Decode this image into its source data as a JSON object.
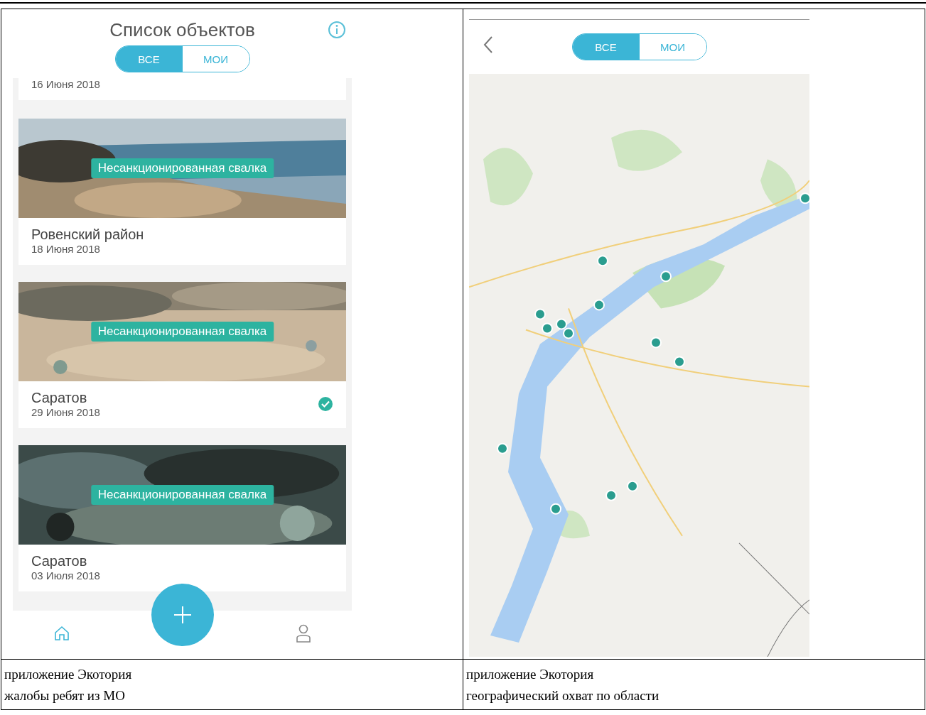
{
  "left_screen": {
    "title": "Список объектов",
    "tabs": [
      {
        "label": "ВСЕ",
        "selected": true
      },
      {
        "label": "МОИ",
        "selected": false
      }
    ],
    "partial_item_date": "16 Июня 2018",
    "items": [
      {
        "badge": "Несанкционированная свалка",
        "title": "Ровенский район",
        "date": "18 Июня 2018",
        "checked": false
      },
      {
        "badge": "Несанкционированная свалка",
        "title": "Саратов",
        "date": "29 Июня 2018",
        "checked": true
      },
      {
        "badge": "Несанкционированная свалка",
        "title": "Саратов",
        "date": "03 Июля 2018",
        "checked": false
      }
    ]
  },
  "right_screen": {
    "tabs": [
      {
        "label": "ВСЕ",
        "selected": true
      },
      {
        "label": "МОИ",
        "selected": false
      }
    ]
  },
  "captions": [
    {
      "lines": [
        "приложение Экотория",
        "жалобы ребят из МО"
      ]
    },
    {
      "lines": [
        "приложение Экотория",
        "географический охват по области"
      ]
    }
  ]
}
